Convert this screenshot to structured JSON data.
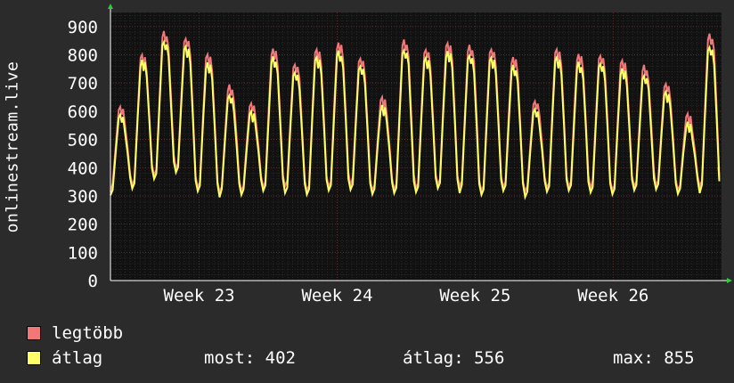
{
  "chart_data": {
    "type": "line",
    "ylabel": "onlinestream.live",
    "ylim": [
      0,
      950
    ],
    "yticks": [
      0,
      100,
      200,
      300,
      400,
      500,
      600,
      700,
      800,
      900
    ],
    "x_labels": [
      "Week 23",
      "Week 24",
      "Week 25",
      "Week 26"
    ],
    "x_days": 31,
    "grid": true,
    "daily_peaks_max": [
      620,
      800,
      880,
      860,
      800,
      690,
      630,
      820,
      770,
      820,
      840,
      790,
      650,
      850,
      820,
      840,
      830,
      820,
      790,
      640,
      820,
      800,
      800,
      780,
      760,
      700,
      590,
      870
    ],
    "daily_troughs_max": [
      320,
      340,
      370,
      400,
      330,
      310,
      320,
      330,
      330,
      320,
      330,
      340,
      320,
      320,
      330,
      340,
      330,
      320,
      330,
      310,
      330,
      330,
      330,
      320,
      330,
      340,
      320,
      330
    ],
    "series": [
      {
        "name": "legtöbb",
        "color": "#f07878",
        "peaks": [
          620,
          800,
          880,
          860,
          800,
          690,
          630,
          820,
          770,
          820,
          840,
          790,
          650,
          850,
          820,
          840,
          830,
          820,
          790,
          640,
          820,
          800,
          800,
          780,
          760,
          700,
          590,
          870
        ],
        "troughs": [
          320,
          340,
          370,
          400,
          330,
          310,
          320,
          330,
          330,
          320,
          330,
          340,
          320,
          320,
          330,
          340,
          330,
          320,
          330,
          310,
          330,
          330,
          330,
          320,
          330,
          340,
          320,
          330
        ]
      },
      {
        "name": "átlag",
        "color": "#ffff66",
        "peaks": [
          590,
          780,
          850,
          830,
          770,
          660,
          600,
          790,
          740,
          790,
          810,
          760,
          620,
          820,
          790,
          810,
          800,
          790,
          760,
          610,
          790,
          770,
          770,
          750,
          730,
          670,
          560,
          830
        ],
        "troughs": [
          305,
          325,
          355,
          385,
          315,
          300,
          305,
          315,
          315,
          305,
          315,
          325,
          305,
          305,
          315,
          325,
          315,
          305,
          315,
          300,
          315,
          315,
          315,
          305,
          315,
          325,
          305,
          315
        ]
      }
    ],
    "last": 402
  },
  "legend": [
    {
      "label": "legtöbb",
      "color": "#f07878"
    },
    {
      "label": "átlag",
      "color": "#ffff66"
    }
  ],
  "stats": {
    "now": "most: 402",
    "avg": "átlag: 556",
    "max": "max: 855"
  }
}
